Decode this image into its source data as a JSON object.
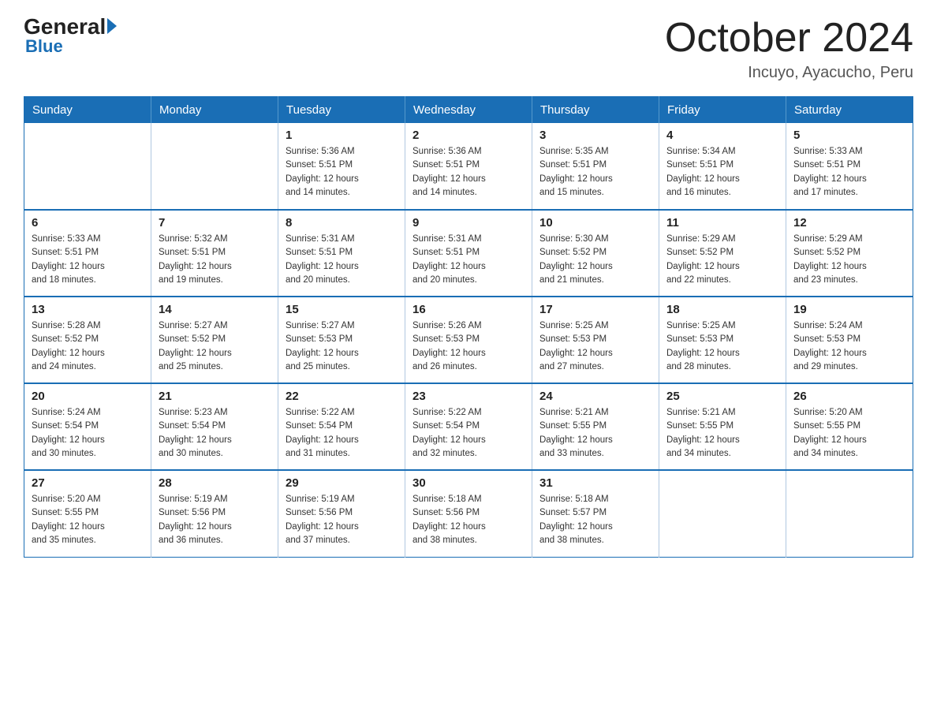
{
  "header": {
    "logo_general": "General",
    "logo_blue": "Blue",
    "title": "October 2024",
    "subtitle": "Incuyo, Ayacucho, Peru"
  },
  "days_of_week": [
    "Sunday",
    "Monday",
    "Tuesday",
    "Wednesday",
    "Thursday",
    "Friday",
    "Saturday"
  ],
  "weeks": [
    [
      {
        "day": "",
        "info": ""
      },
      {
        "day": "",
        "info": ""
      },
      {
        "day": "1",
        "info": "Sunrise: 5:36 AM\nSunset: 5:51 PM\nDaylight: 12 hours\nand 14 minutes."
      },
      {
        "day": "2",
        "info": "Sunrise: 5:36 AM\nSunset: 5:51 PM\nDaylight: 12 hours\nand 14 minutes."
      },
      {
        "day": "3",
        "info": "Sunrise: 5:35 AM\nSunset: 5:51 PM\nDaylight: 12 hours\nand 15 minutes."
      },
      {
        "day": "4",
        "info": "Sunrise: 5:34 AM\nSunset: 5:51 PM\nDaylight: 12 hours\nand 16 minutes."
      },
      {
        "day": "5",
        "info": "Sunrise: 5:33 AM\nSunset: 5:51 PM\nDaylight: 12 hours\nand 17 minutes."
      }
    ],
    [
      {
        "day": "6",
        "info": "Sunrise: 5:33 AM\nSunset: 5:51 PM\nDaylight: 12 hours\nand 18 minutes."
      },
      {
        "day": "7",
        "info": "Sunrise: 5:32 AM\nSunset: 5:51 PM\nDaylight: 12 hours\nand 19 minutes."
      },
      {
        "day": "8",
        "info": "Sunrise: 5:31 AM\nSunset: 5:51 PM\nDaylight: 12 hours\nand 20 minutes."
      },
      {
        "day": "9",
        "info": "Sunrise: 5:31 AM\nSunset: 5:51 PM\nDaylight: 12 hours\nand 20 minutes."
      },
      {
        "day": "10",
        "info": "Sunrise: 5:30 AM\nSunset: 5:52 PM\nDaylight: 12 hours\nand 21 minutes."
      },
      {
        "day": "11",
        "info": "Sunrise: 5:29 AM\nSunset: 5:52 PM\nDaylight: 12 hours\nand 22 minutes."
      },
      {
        "day": "12",
        "info": "Sunrise: 5:29 AM\nSunset: 5:52 PM\nDaylight: 12 hours\nand 23 minutes."
      }
    ],
    [
      {
        "day": "13",
        "info": "Sunrise: 5:28 AM\nSunset: 5:52 PM\nDaylight: 12 hours\nand 24 minutes."
      },
      {
        "day": "14",
        "info": "Sunrise: 5:27 AM\nSunset: 5:52 PM\nDaylight: 12 hours\nand 25 minutes."
      },
      {
        "day": "15",
        "info": "Sunrise: 5:27 AM\nSunset: 5:53 PM\nDaylight: 12 hours\nand 25 minutes."
      },
      {
        "day": "16",
        "info": "Sunrise: 5:26 AM\nSunset: 5:53 PM\nDaylight: 12 hours\nand 26 minutes."
      },
      {
        "day": "17",
        "info": "Sunrise: 5:25 AM\nSunset: 5:53 PM\nDaylight: 12 hours\nand 27 minutes."
      },
      {
        "day": "18",
        "info": "Sunrise: 5:25 AM\nSunset: 5:53 PM\nDaylight: 12 hours\nand 28 minutes."
      },
      {
        "day": "19",
        "info": "Sunrise: 5:24 AM\nSunset: 5:53 PM\nDaylight: 12 hours\nand 29 minutes."
      }
    ],
    [
      {
        "day": "20",
        "info": "Sunrise: 5:24 AM\nSunset: 5:54 PM\nDaylight: 12 hours\nand 30 minutes."
      },
      {
        "day": "21",
        "info": "Sunrise: 5:23 AM\nSunset: 5:54 PM\nDaylight: 12 hours\nand 30 minutes."
      },
      {
        "day": "22",
        "info": "Sunrise: 5:22 AM\nSunset: 5:54 PM\nDaylight: 12 hours\nand 31 minutes."
      },
      {
        "day": "23",
        "info": "Sunrise: 5:22 AM\nSunset: 5:54 PM\nDaylight: 12 hours\nand 32 minutes."
      },
      {
        "day": "24",
        "info": "Sunrise: 5:21 AM\nSunset: 5:55 PM\nDaylight: 12 hours\nand 33 minutes."
      },
      {
        "day": "25",
        "info": "Sunrise: 5:21 AM\nSunset: 5:55 PM\nDaylight: 12 hours\nand 34 minutes."
      },
      {
        "day": "26",
        "info": "Sunrise: 5:20 AM\nSunset: 5:55 PM\nDaylight: 12 hours\nand 34 minutes."
      }
    ],
    [
      {
        "day": "27",
        "info": "Sunrise: 5:20 AM\nSunset: 5:55 PM\nDaylight: 12 hours\nand 35 minutes."
      },
      {
        "day": "28",
        "info": "Sunrise: 5:19 AM\nSunset: 5:56 PM\nDaylight: 12 hours\nand 36 minutes."
      },
      {
        "day": "29",
        "info": "Sunrise: 5:19 AM\nSunset: 5:56 PM\nDaylight: 12 hours\nand 37 minutes."
      },
      {
        "day": "30",
        "info": "Sunrise: 5:18 AM\nSunset: 5:56 PM\nDaylight: 12 hours\nand 38 minutes."
      },
      {
        "day": "31",
        "info": "Sunrise: 5:18 AM\nSunset: 5:57 PM\nDaylight: 12 hours\nand 38 minutes."
      },
      {
        "day": "",
        "info": ""
      },
      {
        "day": "",
        "info": ""
      }
    ]
  ]
}
